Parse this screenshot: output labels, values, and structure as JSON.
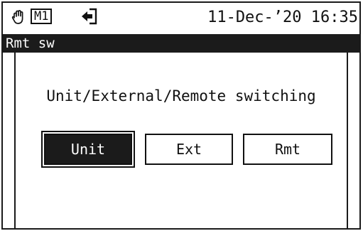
{
  "status_bar": {
    "hand_icon": "hand-icon",
    "mode_badge": "M1",
    "exit_icon": "exit-icon",
    "datetime": "11-Dec-’20 16:35"
  },
  "title_bar": {
    "title": "Rmt sw"
  },
  "main": {
    "prompt": "Unit/External/Remote switching",
    "options": [
      {
        "label": "Unit",
        "selected": true
      },
      {
        "label": "Ext",
        "selected": false
      },
      {
        "label": "Rmt",
        "selected": false
      }
    ]
  },
  "colors": {
    "background": "#ffffff",
    "foreground": "#111111",
    "title_bar": "#1b1b1b",
    "selected": "#1b1b1b"
  }
}
